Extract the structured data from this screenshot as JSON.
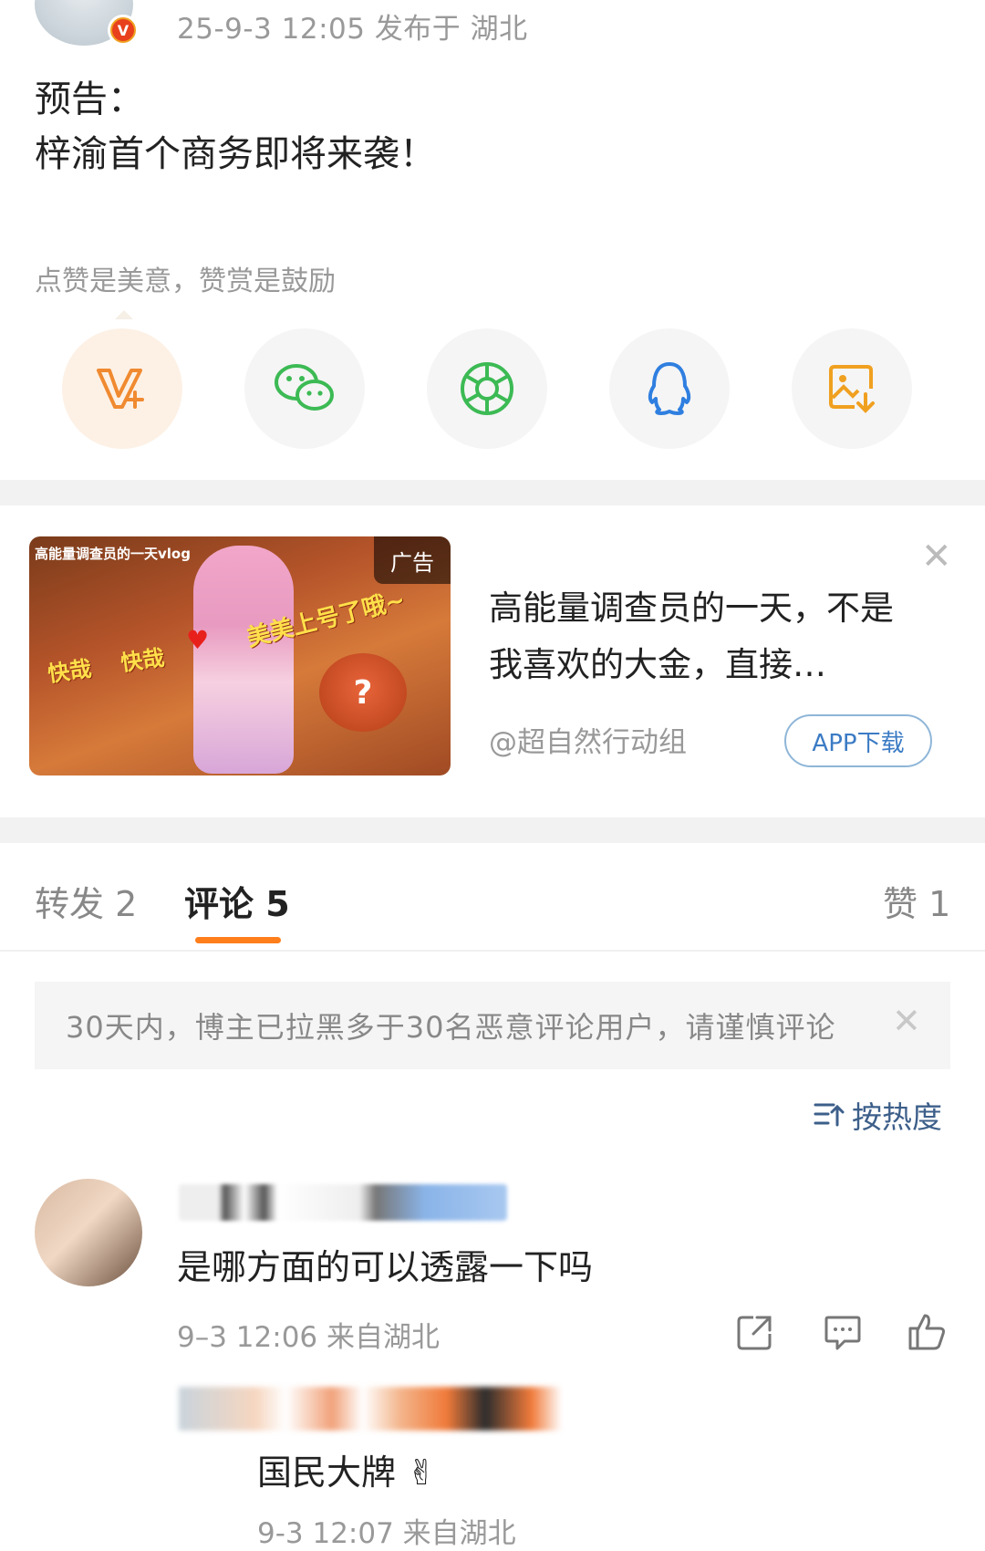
{
  "post": {
    "meta": "25-9-3 12:05  发布于 湖北",
    "line1": "预告：",
    "line2": "梓渝首个商务即将来袭！",
    "reward_hint": "点赞是美意，赞赏是鼓励",
    "verified_badge": "V"
  },
  "share": {
    "icons": [
      "vplus-icon",
      "wechat-icon",
      "moments-icon",
      "qq-icon",
      "save-image-icon"
    ]
  },
  "ad": {
    "image_title": "高能量调查员的一天vlog",
    "tag": "广告",
    "overlay_1": "快哉",
    "overlay_2": "快哉",
    "overlay_3": "美美上号了哦~",
    "mark": "?",
    "text": "高能量调查员的一天，不是我喜欢的大金，直接…",
    "source": "@超自然行动组",
    "button": "APP下载"
  },
  "tabs": {
    "repost": "转发 2",
    "comments": "评论 5",
    "likes": "赞 1"
  },
  "notice": {
    "text": "30天内，博主已拉黑多于30名恶意评论用户，请谨慎评论"
  },
  "sort": {
    "label": "按热度"
  },
  "comments": [
    {
      "text": "是哪方面的可以透露一下吗",
      "meta": "9–3 12:06  来自湖北"
    },
    {
      "text": "国民大牌 ✌",
      "meta": "9-3 12:07  来自湖北"
    }
  ],
  "colors": {
    "accent_orange": "#ff7e1c",
    "link_blue": "#3b7bc4",
    "sort_blue": "#3d5f8a"
  }
}
